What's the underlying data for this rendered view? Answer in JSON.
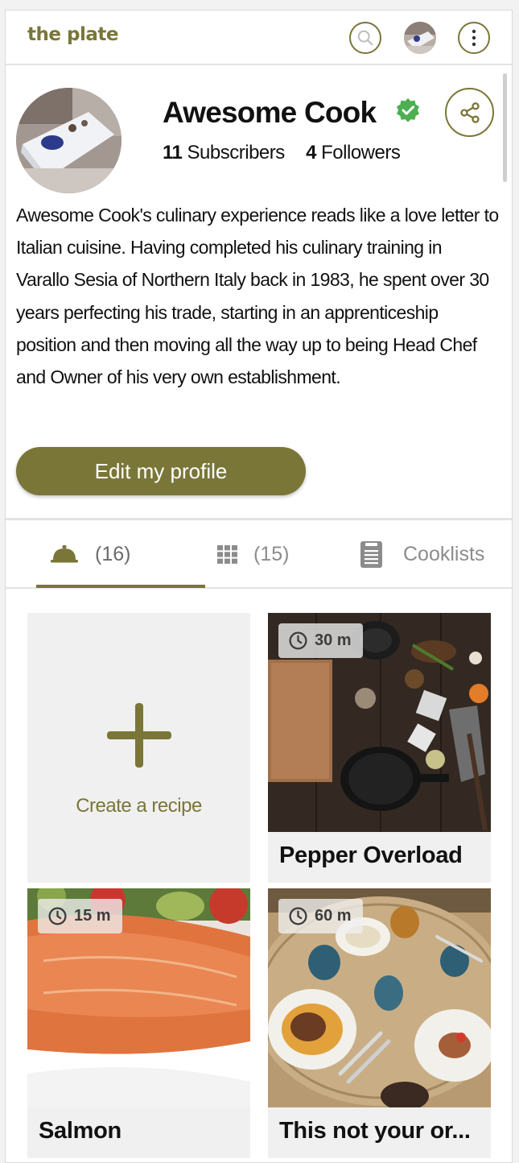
{
  "header": {
    "logo": "the plate",
    "icons": {
      "search": "search-icon",
      "avatar": "user-avatar",
      "more": "more-vertical-icon"
    }
  },
  "profile": {
    "name": "Awesome Cook",
    "verified_icon": "verified-badge-icon",
    "subscribers_count": "11",
    "subscribers_label": "Subscribers",
    "followers_count": "4",
    "followers_label": "Followers",
    "bio": "Awesome Cook's culinary experience reads like a love letter to Italian cuisine. Having completed his culinary training in Varallo Sesia of Northern Italy back in 1983, he spent over 30 years perfecting his trade, starting in an apprenticeship position and then moving all the way up to being Head Chef and Owner of his very own establishment.",
    "edit_button": "Edit my profile",
    "share_icon": "share-icon"
  },
  "tabs": [
    {
      "icon": "cloche-icon",
      "label": "(16)",
      "active": true
    },
    {
      "icon": "grid-icon",
      "label": "(15)",
      "active": false
    },
    {
      "icon": "notepad-icon",
      "label": "Cooklists",
      "active": false
    }
  ],
  "grid": {
    "create_label": "Create a recipe",
    "recipes": [
      {
        "title": "Pepper Overload",
        "time": "30 m"
      },
      {
        "title": "Salmon",
        "time": "15 m"
      },
      {
        "title": "This not your or...",
        "time": "60 m"
      }
    ]
  },
  "colors": {
    "accent": "#7a7638",
    "verified": "#4caf50",
    "card_bg": "#f0f0f0",
    "divider": "#e3e3e3"
  }
}
